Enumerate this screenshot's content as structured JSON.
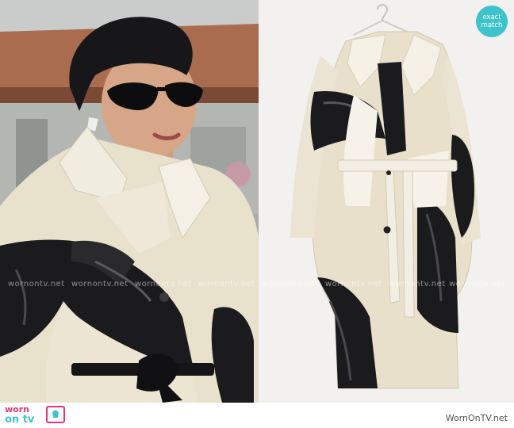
{
  "badge": {
    "line1": "exact",
    "line2": "match"
  },
  "watermark": {
    "text": "wornontv.net"
  },
  "logo": {
    "word1": "worn",
    "word2": "on tv"
  },
  "footer": {
    "site": "WornOnTV.net"
  },
  "colors": {
    "brand_pink": "#e6347a",
    "brand_teal": "#3cc3cc",
    "coat_cream": "#e9e0cc",
    "coat_black": "#1b1b1d"
  }
}
